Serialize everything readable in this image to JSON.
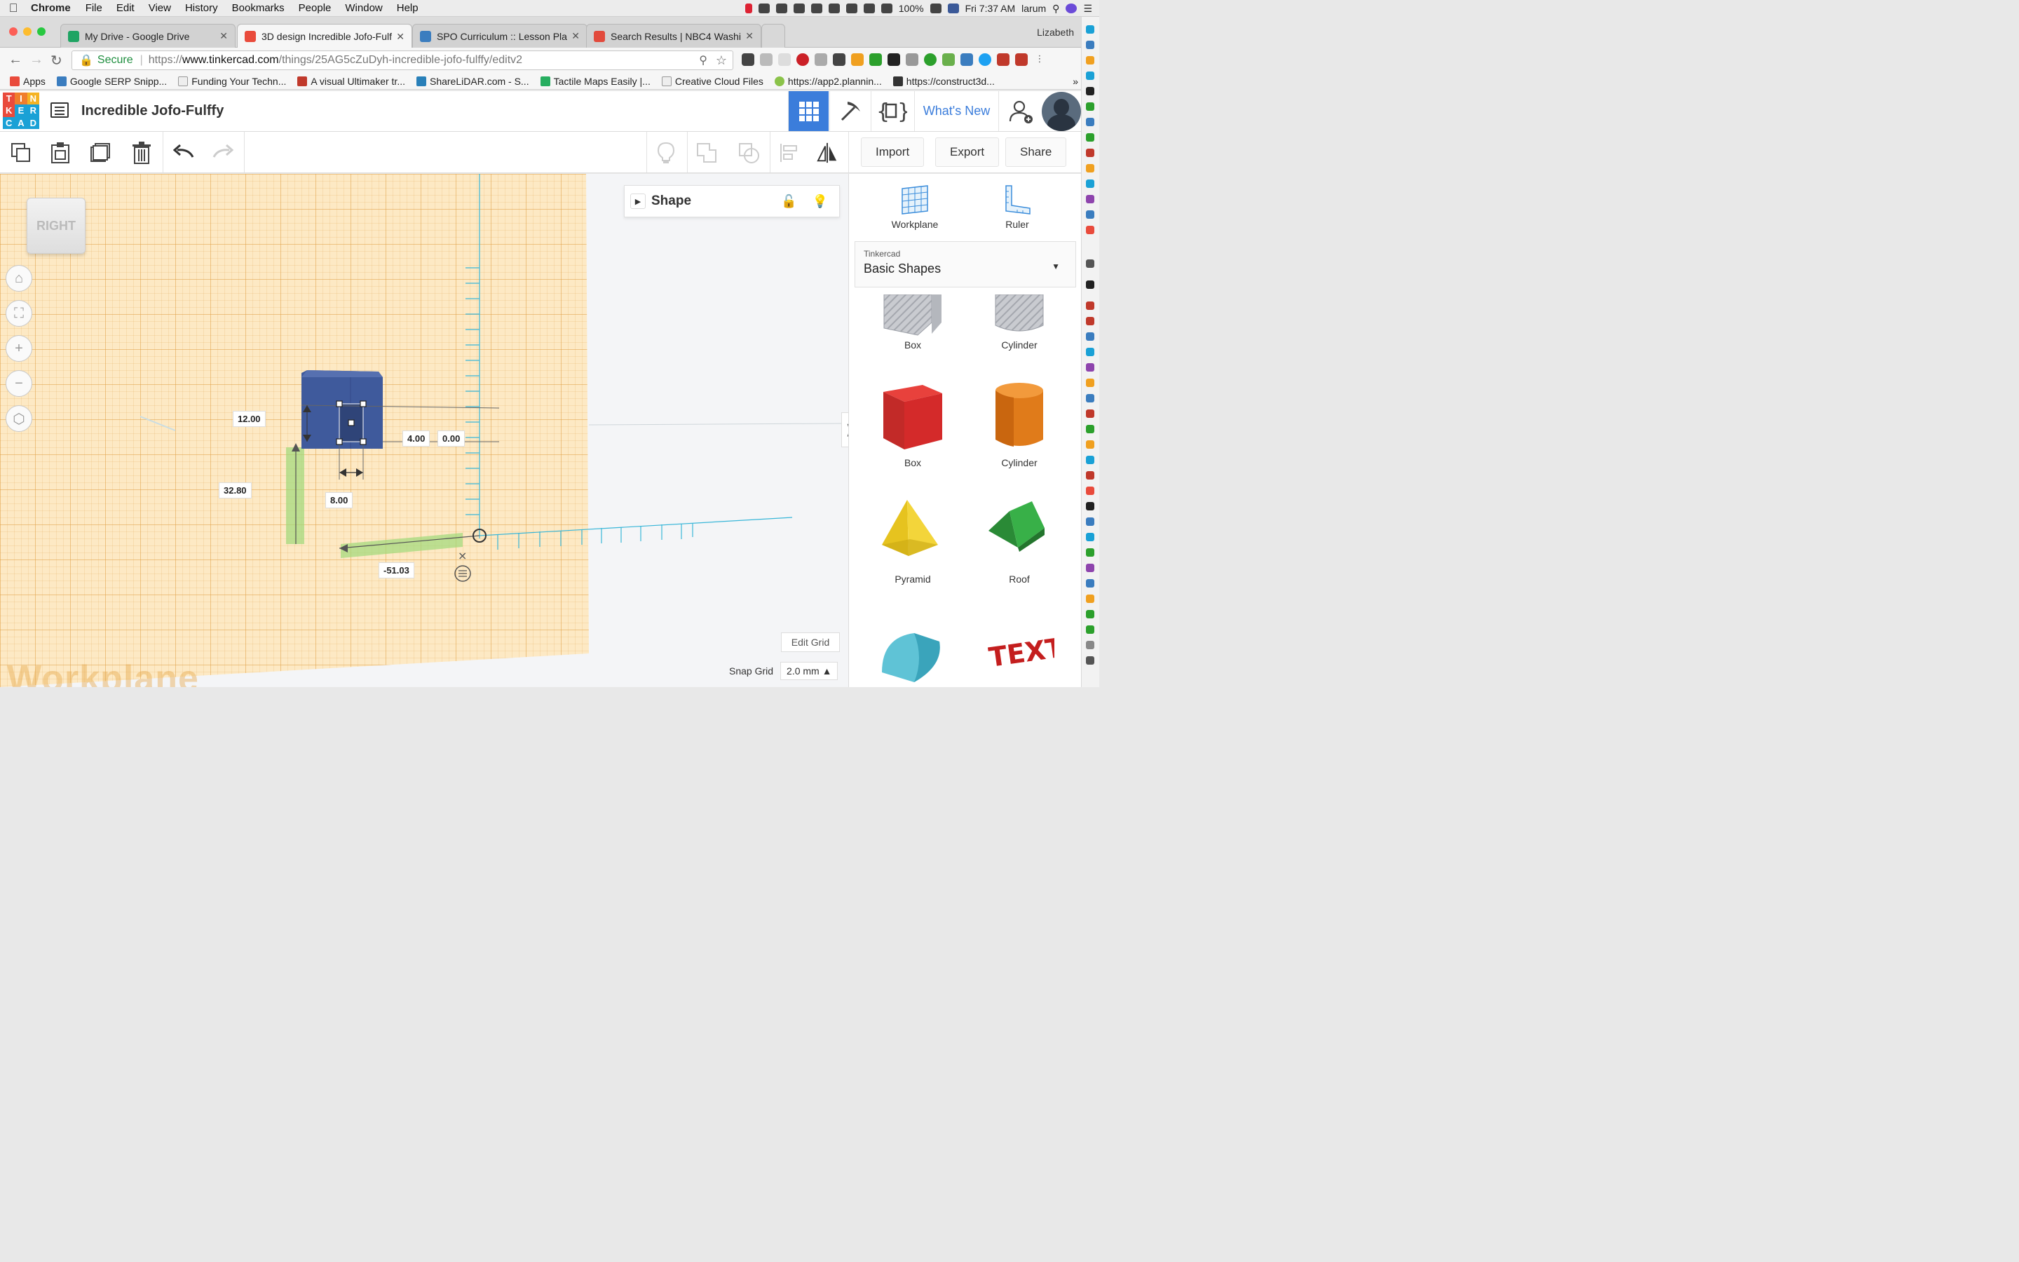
{
  "menubar": {
    "app": "Chrome",
    "items": [
      "File",
      "Edit",
      "View",
      "History",
      "Bookmarks",
      "People",
      "Window",
      "Help"
    ],
    "battery": "100%",
    "clock": "Fri 7:37 AM",
    "user": "larum"
  },
  "tabs": [
    {
      "title": "My Drive - Google Drive",
      "color": "#1fa463"
    },
    {
      "title": "3D design Incredible Jofo-Fulf",
      "color": "#e94b3c"
    },
    {
      "title": "SPO Curriculum :: Lesson Plan",
      "color": "#3b7dbf"
    },
    {
      "title": "Search Results | NBC4 Washin",
      "color": "#e24a3c"
    }
  ],
  "profile_name": "Lizabeth",
  "address": {
    "secure": "Secure",
    "scheme": "https://",
    "host": "www.tinkercad.com",
    "path": "/things/25AG5cZuDyh-incredible-jofo-fulffy/editv2"
  },
  "bookmarks": [
    {
      "label": "Apps",
      "color": "#e94b3c"
    },
    {
      "label": "Google SERP Snipp...",
      "color": "#3b7dbf"
    },
    {
      "label": "Funding Your Techn...",
      "color": "#999999"
    },
    {
      "label": "A visual Ultimaker tr...",
      "color": "#c0392b"
    },
    {
      "label": "ShareLiDAR.com - S...",
      "color": "#2980b9"
    },
    {
      "label": "Tactile Maps Easily |...",
      "color": "#27ae60"
    },
    {
      "label": "Creative Cloud Files",
      "color": "#999999"
    },
    {
      "label": "https://app2.plannin...",
      "color": "#8bc34a"
    },
    {
      "label": "https://construct3d...",
      "color": "#333333"
    }
  ],
  "tinkercad": {
    "logo_letters": [
      "T",
      "I",
      "N",
      "K",
      "E",
      "R",
      "C",
      "A",
      "D"
    ],
    "design_title": "Incredible Jofo-Fulffy",
    "whats_new": "What's New",
    "toolbar": {
      "import": "Import",
      "export": "Export",
      "share": "Share"
    },
    "viewcube": "RIGHT",
    "workplane_watermark": "Workplane",
    "shape_panel_title": "Shape",
    "dimensions": {
      "height": "12.00",
      "width_right": "4.00",
      "elevation": "0.00",
      "depth": "8.00",
      "distance_y": "32.80",
      "distance_x": "-51.03"
    },
    "edit_grid": "Edit Grid",
    "snap_grid_label": "Snap Grid",
    "snap_grid_value": "2.0 mm",
    "right_panel": {
      "workplane": "Workplane",
      "ruler": "Ruler",
      "library_owner": "Tinkercad",
      "library_name": "Basic Shapes",
      "shapes": [
        "Box",
        "Cylinder",
        "Box",
        "Cylinder",
        "Pyramid",
        "Roof"
      ]
    }
  },
  "colors": {
    "accent": "#3b7ddb",
    "grid": "#fde9c4",
    "selected_shape": "#3f5a9c",
    "box_red": "#d42a2a",
    "cylinder_orange": "#e07b1a",
    "pyramid_yellow": "#e6c31f",
    "roof_green": "#2e9a3c"
  }
}
